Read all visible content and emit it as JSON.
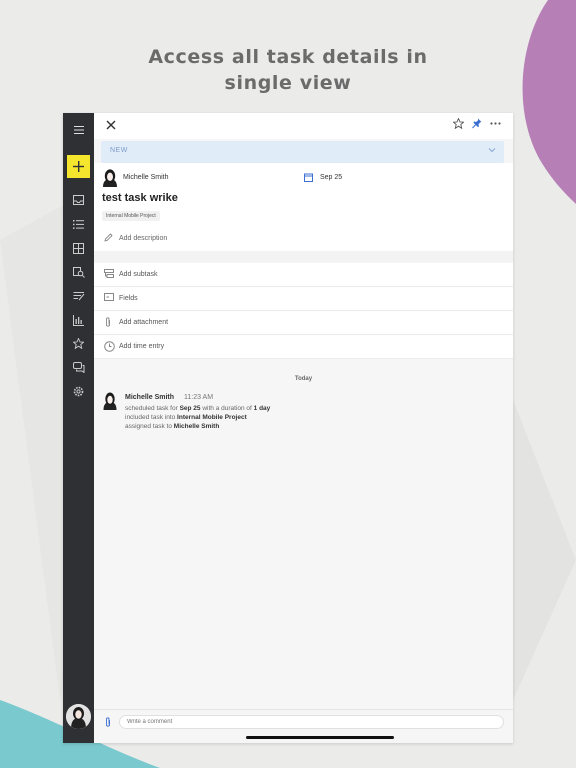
{
  "promo": {
    "line1": "Access all task details in",
    "line2": "single view"
  },
  "colors": {
    "purple_blob": "#b67fb5",
    "teal_blob": "#79c9cf",
    "sidebar_bg": "#2f3034",
    "plus_button": "#f5e52c",
    "status_bg": "#e1ecf9"
  },
  "sidebar": {
    "icons": [
      "menu-icon",
      "add-icon",
      "inbox-icon",
      "list-icon",
      "dashboard-icon",
      "search-icon",
      "stream-icon",
      "reports-icon",
      "star-icon",
      "chat-icon",
      "settings-icon",
      "avatar"
    ]
  },
  "task": {
    "status": "NEW",
    "assignee": "Michelle Smith",
    "due_date": "Sep 25",
    "title": "test task wrike",
    "project_tag": "Internal Mobile Project",
    "add_description": "Add description"
  },
  "actions": [
    {
      "label": "Add subtask",
      "icon": "subtask-icon"
    },
    {
      "label": "Fields",
      "icon": "fields-icon"
    },
    {
      "label": "Add attachment",
      "icon": "paperclip-icon"
    },
    {
      "label": "Add time entry",
      "icon": "clock-icon"
    }
  ],
  "feed": {
    "day": "Today",
    "author": "Michelle Smith",
    "time": "11:23 AM",
    "line1_pre": "scheduled task for ",
    "line1_date": "Sep 25",
    "line1_mid": " with a duration of ",
    "line1_dur": "1 day",
    "line2_pre": "included task into ",
    "line2_proj": "Internal Mobile Project",
    "line3_pre": "assigned task to ",
    "line3_user": "Michelle Smith"
  },
  "composer": {
    "placeholder": "Write a comment"
  }
}
